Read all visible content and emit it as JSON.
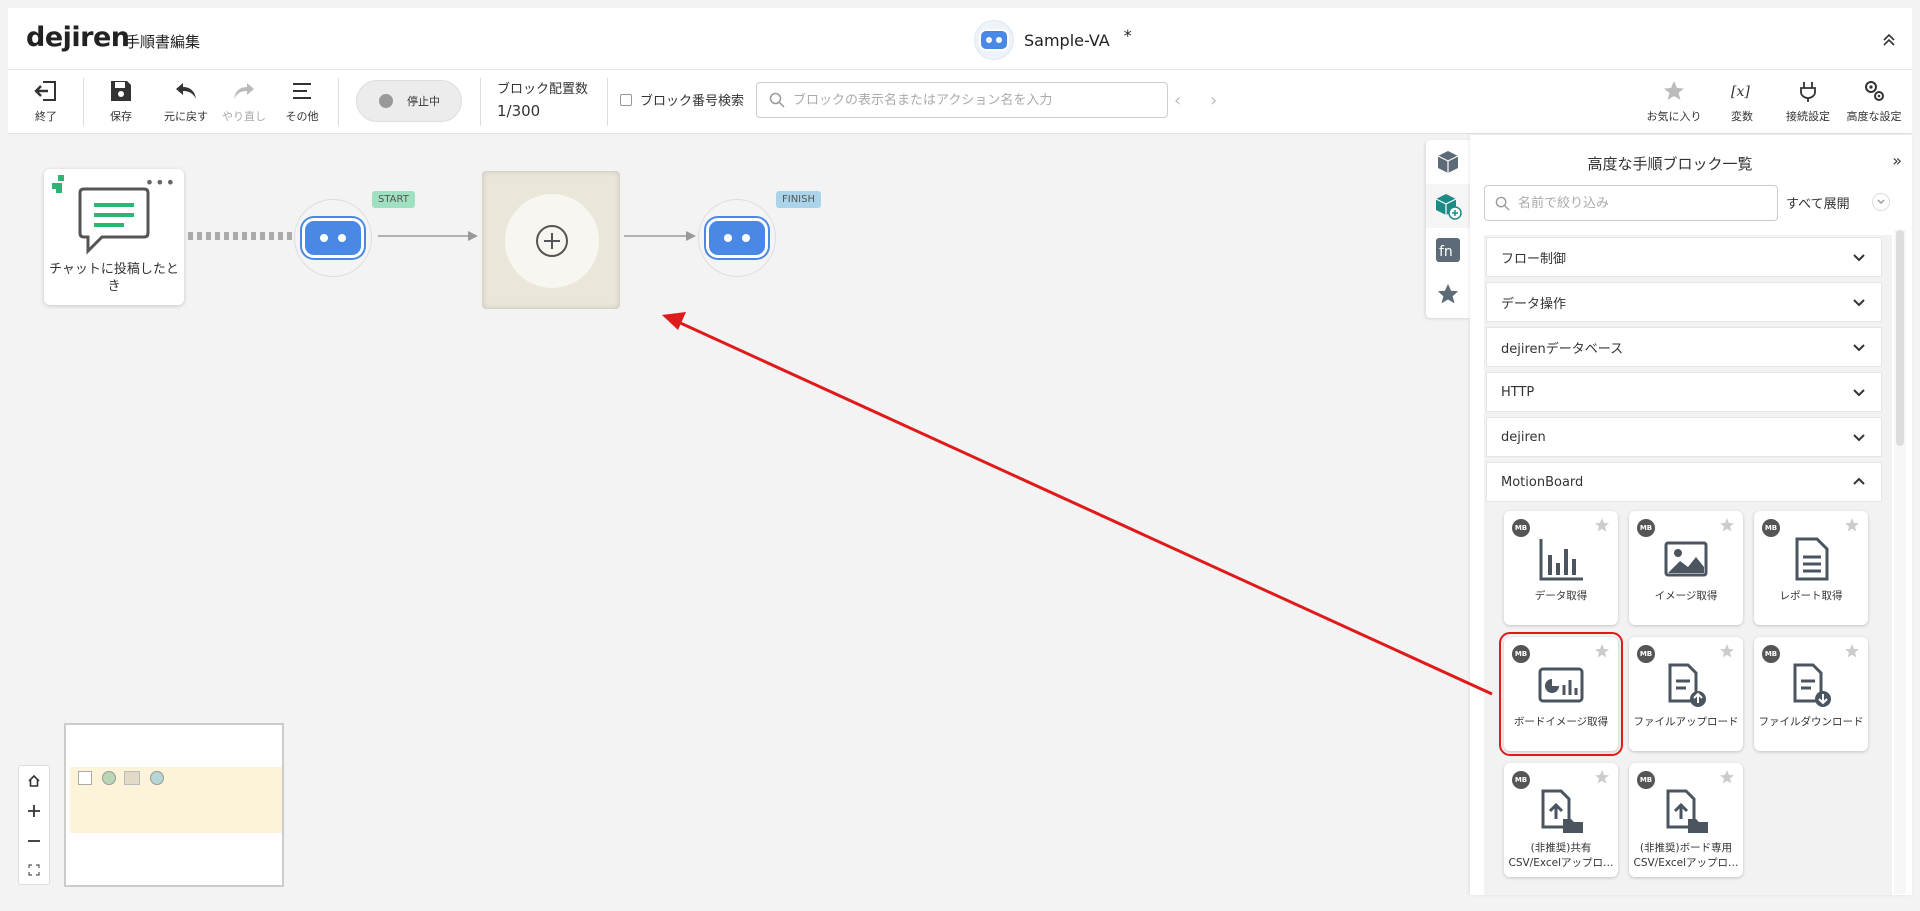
{
  "header": {
    "logo": "dejiren",
    "page_title": "手順書編集",
    "va_name": "Sample-VA",
    "unsaved_marker": "*"
  },
  "toolbar": {
    "exit_label": "終了",
    "save_label": "保存",
    "undo_label": "元に戻す",
    "redo_label": "やり直し",
    "other_label": "その他",
    "run_status": "停止中",
    "block_count_title": "ブロック配置数",
    "block_count_value": "1/300",
    "block_number_search_label": "ブロック番号検索",
    "search_placeholder": "ブロックの表示名またはアクション名を入力",
    "favorites_label": "お気に入り",
    "variables_label": "変数",
    "connection_label": "接続設定",
    "advanced_label": "高度な設定"
  },
  "canvas": {
    "trigger_label": "チャットに投稿したとき",
    "start_tag": "START",
    "finish_tag": "FINISH"
  },
  "panel": {
    "title": "高度な手順ブロック一覧",
    "filter_placeholder": "名前で絞り込み",
    "expand_all": "すべて展開",
    "categories": [
      {
        "label": "フロー制御",
        "expanded": false
      },
      {
        "label": "データ操作",
        "expanded": false
      },
      {
        "label": "dejirenデータベース",
        "expanded": false
      },
      {
        "label": "HTTP",
        "expanded": false
      },
      {
        "label": "dejiren",
        "expanded": false
      },
      {
        "label": "MotionBoard",
        "expanded": true
      }
    ],
    "badge": "MB",
    "blocks": [
      {
        "label": "データ取得",
        "icon": "bar-chart-icon"
      },
      {
        "label": "イメージ取得",
        "icon": "image-icon"
      },
      {
        "label": "レポート取得",
        "icon": "document-icon"
      },
      {
        "label": "ボードイメージ取得",
        "icon": "board-image-icon",
        "selected": true
      },
      {
        "label": "ファイルアップロード",
        "icon": "file-upload-icon"
      },
      {
        "label": "ファイルダウンロード",
        "icon": "file-download-icon"
      },
      {
        "label": "(非推奨)共有CSV/Excelアップロ…",
        "icon": "shared-csv-upload-icon"
      },
      {
        "label": "(非推奨)ボード専用CSV/Excelアップロ…",
        "icon": "board-csv-upload-icon"
      }
    ]
  },
  "colors": {
    "accent_blue": "#4a88e5",
    "start_tag": "#9fe0c1",
    "finish_tag": "#a9d4ea",
    "highlight_red": "#e01a1a",
    "trigger_green": "#2bb673"
  }
}
